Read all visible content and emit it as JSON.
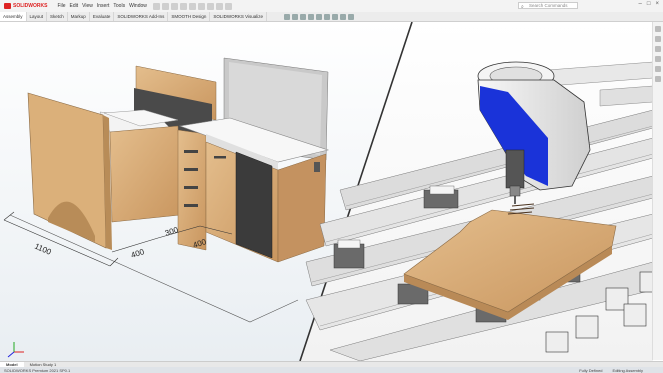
{
  "app": {
    "logo_text": "SOLIDWORKS",
    "version_text": "SOLIDWORKS Premium 2021 SP0.1"
  },
  "menu": [
    "File",
    "Edit",
    "View",
    "Insert",
    "Tools",
    "Window"
  ],
  "search": {
    "placeholder": "Search Commands"
  },
  "tabs": [
    "Assembly",
    "Layout",
    "Sketch",
    "Markup",
    "Evaluate",
    "SOLIDWORKS Add-Ins",
    "SMOOTH Design",
    "SOLIDWORKS Visualize"
  ],
  "bottom_tabs": [
    "Model",
    "Motion Study 1"
  ],
  "status": {
    "defined": "Fully Defined",
    "mode": "Editing Assembly"
  },
  "dimensions": {
    "width": "1100",
    "d1": "400",
    "d2": "300",
    "d3": "400"
  },
  "colors": {
    "wood": "#d6aa78",
    "white": "#f4f4f4",
    "dark": "#444",
    "spindle_blue": "#1a33d9",
    "accent_red": "#d22"
  }
}
